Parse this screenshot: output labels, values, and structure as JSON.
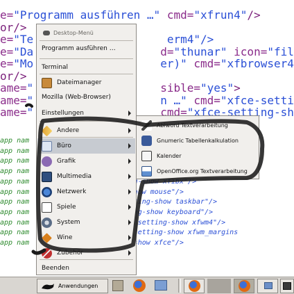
{
  "editor": {
    "big_lines": [
      {
        "parts": [
          {
            "t": "e=",
            "c": "c-attr"
          },
          {
            "t": "\"Programm ausführen …\"",
            "c": "c-str"
          },
          {
            "t": " cmd=",
            "c": "c-attr"
          },
          {
            "t": "\"xfrun4\"",
            "c": "c-str"
          },
          {
            "t": "/>",
            "c": "c-tag"
          }
        ]
      },
      {
        "parts": [
          {
            "t": "or/>",
            "c": "c-tag"
          }
        ]
      },
      {
        "parts": [
          {
            "t": "e=",
            "c": "c-attr"
          },
          {
            "t": "\"Te",
            "c": "c-str"
          },
          {
            "t": "                    ",
            "c": "c-eq"
          },
          {
            "t": "erm4\"/>",
            "c": "c-str"
          }
        ]
      },
      {
        "parts": [
          {
            "t": "e=",
            "c": "c-attr"
          },
          {
            "t": "\"Da",
            "c": "c-str"
          },
          {
            "t": "                   ",
            "c": "c-eq"
          },
          {
            "t": "d=",
            "c": "c-attr"
          },
          {
            "t": "\"thunar\"",
            "c": "c-str"
          },
          {
            "t": " icon=",
            "c": "c-attr"
          },
          {
            "t": "\"file-mana",
            "c": "c-str"
          }
        ]
      },
      {
        "parts": [
          {
            "t": "e=",
            "c": "c-attr"
          },
          {
            "t": "\"Mo",
            "c": "c-str"
          },
          {
            "t": "                   ",
            "c": "c-eq"
          },
          {
            "t": "er)\"",
            "c": "c-str"
          },
          {
            "t": " cmd=",
            "c": "c-attr"
          },
          {
            "t": "\"xfbrowser4\"",
            "c": "c-str"
          },
          {
            "t": "/>",
            "c": "c-tag"
          }
        ]
      },
      {
        "parts": [
          {
            "t": "or/>",
            "c": "c-tag"
          }
        ]
      },
      {
        "parts": [
          {
            "t": "ame=",
            "c": "c-attr"
          },
          {
            "t": "\"",
            "c": "c-str"
          },
          {
            "t": "                   ",
            "c": "c-eq"
          },
          {
            "t": "sible=",
            "c": "c-attr"
          },
          {
            "t": "\"yes\"",
            "c": "c-str"
          },
          {
            "t": ">",
            "c": "c-tag"
          }
        ]
      },
      {
        "parts": [
          {
            "t": "ame=",
            "c": "c-attr"
          },
          {
            "t": "\"",
            "c": "c-str"
          },
          {
            "t": "                   ",
            "c": "c-eq"
          },
          {
            "t": "n …\"",
            "c": "c-str"
          },
          {
            "t": " cmd=",
            "c": "c-attr"
          },
          {
            "t": "\"xfce-setting-sho",
            "c": "c-str"
          }
        ]
      },
      {
        "parts": [
          {
            "t": "ame=",
            "c": "c-attr"
          },
          {
            "t": "\"",
            "c": "c-str"
          },
          {
            "t": "                   ",
            "c": "c-eq"
          },
          {
            "t": "cmd=",
            "c": "c-attr"
          },
          {
            "t": "\"xfce-setting-show ba",
            "c": "c-str"
          }
        ]
      }
    ],
    "small_lines": [
      {
        "parts": [
          {
            "t": "app nam",
            "c": "c-green"
          },
          {
            "t": "                                                  />",
            "c": "c-blue"
          }
        ]
      },
      {
        "parts": [
          {
            "t": "app nam",
            "c": "c-green"
          },
          {
            "t": "                                                  \"/>",
            "c": "c-blue"
          }
        ]
      },
      {
        "parts": [
          {
            "t": "app nam",
            "c": "c-green"
          },
          {
            "t": "                                                 ffm\"/>",
            "c": "c-blue"
          }
        ]
      },
      {
        "parts": [
          {
            "t": "app nam",
            "c": "c-green"
          },
          {
            "t": "                                                ng-show",
            "c": "c-blue"
          }
        ]
      },
      {
        "parts": [
          {
            "t": "app nam",
            "c": "c-green"
          },
          {
            "t": "                  -setting-show xfibx\"/>",
            "c": "c-blue"
          }
        ]
      },
      {
        "parts": [
          {
            "t": "app nam",
            "c": "c-green"
          },
          {
            "t": "                  tting-show mouse\"/>",
            "c": "c-blue"
          }
        ]
      },
      {
        "parts": [
          {
            "t": "app nam",
            "c": "c-green"
          },
          {
            "t": "                  fce-setting-show taskbar\"/>",
            "c": "c-blue"
          }
        ]
      },
      {
        "parts": [
          {
            "t": "app nam",
            "c": "c-green"
          },
          {
            "t": "                  e-setting-show keyboard\"/>",
            "c": "c-blue"
          }
        ]
      },
      {
        "parts": [
          {
            "t": "app nam",
            "c": "c-green"
          },
          {
            "t": "                  d=\"xfce-setting-show xfwm4\"/>",
            "c": "c-blue"
          }
        ]
      },
      {
        "parts": [
          {
            "t": "app nam",
            "c": "c-green"
          },
          {
            "t": "                   \"xfce-setting-show xfwm_margins",
            "c": "c-blue"
          }
        ]
      },
      {
        "parts": [
          {
            "t": "app nam",
            "c": "c-green"
          },
          {
            "t": "                  etting-show xfce\"/>",
            "c": "c-blue"
          }
        ]
      }
    ]
  },
  "menu": {
    "header": "Desktop-Menü",
    "items": [
      {
        "label": "Programm ausführen …",
        "icon": "none",
        "arrow": false
      },
      {
        "label": "Terminal",
        "icon": "none",
        "arrow": false
      },
      {
        "label": "Dateimanager",
        "icon": "file-manager-icon",
        "arrow": false
      },
      {
        "label": "Mozilla (Web-Browser)",
        "icon": "none",
        "arrow": false
      },
      {
        "label": "Einstellungen",
        "icon": "none",
        "arrow": true
      },
      {
        "label": "Andere",
        "icon": "other-icon",
        "arrow": true
      },
      {
        "label": "Büro",
        "icon": "office-icon",
        "arrow": true
      },
      {
        "label": "Grafik",
        "icon": "graphics-icon",
        "arrow": true
      },
      {
        "label": "Multimedia",
        "icon": "multimedia-icon",
        "arrow": true
      },
      {
        "label": "Netzwerk",
        "icon": "network-icon",
        "arrow": true
      },
      {
        "label": "Spiele",
        "icon": "games-icon",
        "arrow": true
      },
      {
        "label": "System",
        "icon": "system-icon",
        "arrow": true
      },
      {
        "label": "Wine",
        "icon": "wine-icon",
        "arrow": true
      },
      {
        "label": "Zubehör",
        "icon": "accessories-icon",
        "arrow": true
      },
      {
        "label": "Beenden",
        "icon": "none",
        "arrow": false
      }
    ]
  },
  "submenu": {
    "items": [
      {
        "label": "Abiword Textverarbeitung",
        "icon": "abiword-icon"
      },
      {
        "label": "Gnumeric Tabellenkalkulation",
        "icon": "gnumeric-icon"
      },
      {
        "label": "Kalender",
        "icon": "calendar-icon"
      },
      {
        "label": "OpenOffice.org Textverarbeitung",
        "icon": "openoffice-icon"
      }
    ]
  },
  "panel": {
    "start_label": "Anwendungen",
    "launchers": [
      "image-viewer-icon",
      "firefox-icon",
      "network-folder-icon"
    ],
    "tasks": [
      "firefox-task-icon",
      "window-task-icon",
      "firefox-task-icon",
      "folder-task-icon",
      "terminal-task-icon"
    ]
  },
  "colors": {
    "highlight": "#c7cbd1",
    "menu_bg": "#f1efec",
    "panel_bg": "#d9d6d1"
  }
}
